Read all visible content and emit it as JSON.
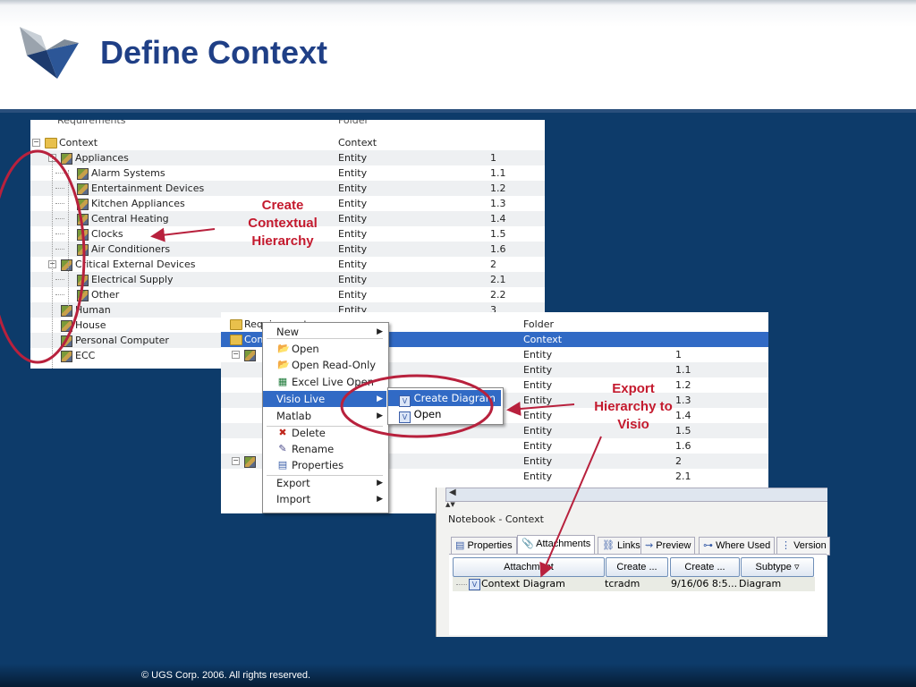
{
  "slide": {
    "title": "Define Context",
    "copyright": "© UGS Corp. 2006. All rights reserved."
  },
  "tree_window_1": {
    "partial_top_row": {
      "name": "Requirements",
      "type": "Folder"
    },
    "rows": [
      {
        "name": "Context",
        "type": "Context",
        "id": "",
        "level": 0,
        "icon": "folder-icon"
      },
      {
        "name": "Appliances",
        "type": "Entity",
        "id": "1",
        "level": 1,
        "icon": "entity-icon"
      },
      {
        "name": "Alarm Systems",
        "type": "Entity",
        "id": "1.1",
        "level": 2,
        "icon": "entity-icon"
      },
      {
        "name": "Entertainment Devices",
        "type": "Entity",
        "id": "1.2",
        "level": 2,
        "icon": "entity-icon"
      },
      {
        "name": "Kitchen Appliances",
        "type": "Entity",
        "id": "1.3",
        "level": 2,
        "icon": "entity-icon"
      },
      {
        "name": "Central Heating",
        "type": "Entity",
        "id": "1.4",
        "level": 2,
        "icon": "entity-icon"
      },
      {
        "name": "Clocks",
        "type": "Entity",
        "id": "1.5",
        "level": 2,
        "icon": "entity-icon"
      },
      {
        "name": "Air Conditioners",
        "type": "Entity",
        "id": "1.6",
        "level": 2,
        "icon": "entity-icon"
      },
      {
        "name": "Critical External Devices",
        "type": "Entity",
        "id": "2",
        "level": 1,
        "icon": "entity-icon"
      },
      {
        "name": "Electrical Supply",
        "type": "Entity",
        "id": "2.1",
        "level": 2,
        "icon": "entity-icon"
      },
      {
        "name": "Other",
        "type": "Entity",
        "id": "2.2",
        "level": 2,
        "icon": "entity-icon"
      },
      {
        "name": "Human",
        "type": "Entity",
        "id": "3",
        "level": 1,
        "icon": "entity-icon"
      },
      {
        "name": "House",
        "type": "",
        "id": "",
        "level": 1,
        "icon": "entity-icon"
      },
      {
        "name": "Personal Computer",
        "type": "",
        "id": "",
        "level": 1,
        "icon": "entity-icon"
      },
      {
        "name": "ECC",
        "type": "",
        "id": "",
        "level": 1,
        "icon": "entity-icon"
      }
    ]
  },
  "tree_window_2": {
    "rows": [
      {
        "name": "Requirements",
        "type": "Folder",
        "id": "",
        "selected": false
      },
      {
        "name": "Context",
        "type": "Context",
        "id": "",
        "selected": true
      },
      {
        "name": "",
        "type": "Entity",
        "id": "1",
        "selected": false
      },
      {
        "name": "",
        "type": "Entity",
        "id": "1.1",
        "selected": false
      },
      {
        "name": "",
        "type": "Entity",
        "id": "1.2",
        "selected": false
      },
      {
        "name": "",
        "type": "Entity",
        "id": "1.3",
        "selected": false
      },
      {
        "name": "",
        "type": "Entity",
        "id": "1.4",
        "selected": false
      },
      {
        "name": "",
        "type": "Entity",
        "id": "1.5",
        "selected": false
      },
      {
        "name": "",
        "type": "Entity",
        "id": "1.6",
        "selected": false
      },
      {
        "name": "",
        "type": "Entity",
        "id": "2",
        "selected": false
      },
      {
        "name": "",
        "type": "Entity",
        "id": "2.1",
        "selected": false
      }
    ]
  },
  "context_menu": {
    "items": [
      {
        "label": "New",
        "icon": "",
        "submenu": true,
        "highlighted": false
      },
      {
        "label": "Open",
        "icon": "open-icon",
        "submenu": false,
        "highlighted": false
      },
      {
        "label": "Open Read-Only",
        "icon": "open-read-only-icon",
        "submenu": false,
        "highlighted": false
      },
      {
        "label": "Excel Live Open",
        "icon": "excel-icon",
        "submenu": false,
        "highlighted": false
      },
      {
        "label": "Visio Live",
        "icon": "",
        "submenu": true,
        "highlighted": true
      },
      {
        "label": "Matlab",
        "icon": "",
        "submenu": true,
        "highlighted": false
      },
      {
        "label": "Delete",
        "icon": "delete-icon",
        "submenu": false,
        "highlighted": false
      },
      {
        "label": "Rename",
        "icon": "rename-icon",
        "submenu": false,
        "highlighted": false
      },
      {
        "label": "Properties",
        "icon": "properties-icon",
        "submenu": false,
        "highlighted": false
      },
      {
        "label": "Export",
        "icon": "",
        "submenu": true,
        "highlighted": false
      },
      {
        "label": "Import",
        "icon": "",
        "submenu": true,
        "highlighted": false
      }
    ]
  },
  "visio_submenu": {
    "items": [
      {
        "label": "Create Diagram",
        "highlighted": true
      },
      {
        "label": "Open",
        "highlighted": false
      }
    ]
  },
  "notebook": {
    "title": "Notebook - Context",
    "tabs": [
      {
        "label": "Properties",
        "active": false
      },
      {
        "label": "Attachments",
        "active": true
      },
      {
        "label": "Links",
        "active": false
      },
      {
        "label": "Preview",
        "active": false
      },
      {
        "label": "Where Used",
        "active": false
      },
      {
        "label": "Version",
        "active": false
      }
    ],
    "columns": [
      "Attachment",
      "Create ...",
      "Create ...",
      "Subtype"
    ],
    "row": {
      "name": "Context Diagram",
      "creator": "tcradm",
      "date": "9/16/06 8:5...",
      "subtype": "Diagram"
    }
  },
  "callouts": {
    "create": [
      "Create",
      "Contextual",
      "Hierarchy"
    ],
    "export": [
      "Export",
      "Hierarchy to",
      "Visio"
    ],
    "color": "#c41a2e"
  },
  "colors": {
    "background": "#0d3b6a",
    "title": "#1f3f86",
    "selection": "#316ac5",
    "callout_ring": "#b8213d"
  }
}
